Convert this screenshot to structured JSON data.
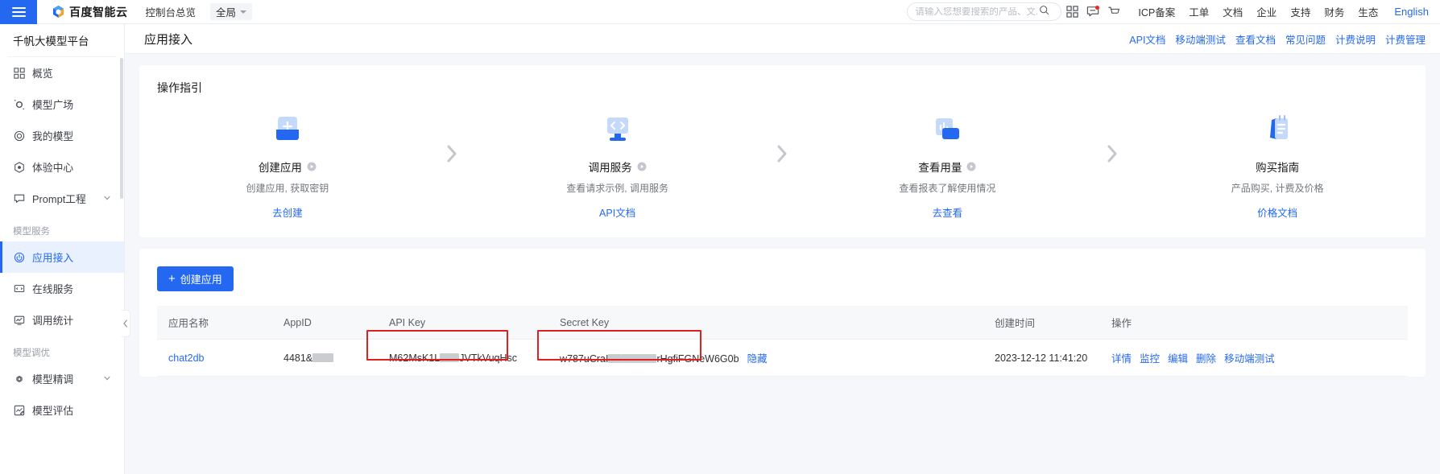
{
  "topbar": {
    "menu_icon": "hamburger-icon",
    "brand": "百度智能云",
    "console_link": "控制台总览",
    "scope": "全局",
    "search_placeholder": "请输入您想要搜索的产品、文...",
    "icons": [
      "grid-apps-icon",
      "message-icon",
      "cart-icon"
    ],
    "nav": [
      {
        "label": "ICP备案"
      },
      {
        "label": "工单"
      },
      {
        "label": "文档"
      },
      {
        "label": "企业"
      },
      {
        "label": "支持"
      },
      {
        "label": "财务"
      },
      {
        "label": "生态"
      }
    ],
    "language": "English"
  },
  "sidebar": {
    "title": "千帆大模型平台",
    "items": [
      {
        "label": "概览",
        "icon": "grid-icon",
        "active": false,
        "expandable": false
      },
      {
        "label": "模型广场",
        "icon": "cube-icon",
        "active": false,
        "expandable": false
      },
      {
        "label": "我的模型",
        "icon": "target-icon",
        "active": false,
        "expandable": false
      },
      {
        "label": "体验中心",
        "icon": "hexagon-icon",
        "active": false,
        "expandable": false
      },
      {
        "label": "Prompt工程",
        "icon": "chat-icon",
        "active": false,
        "expandable": true
      }
    ],
    "groups": [
      {
        "label": "模型服务",
        "items": [
          {
            "label": "应用接入",
            "icon": "power-icon",
            "active": true,
            "expandable": false
          },
          {
            "label": "在线服务",
            "icon": "monitor-icon",
            "active": false,
            "expandable": false
          },
          {
            "label": "调用统计",
            "icon": "chart-icon",
            "active": false,
            "expandable": false
          }
        ]
      },
      {
        "label": "模型调优",
        "items": [
          {
            "label": "模型精调",
            "icon": "gear-icon",
            "active": false,
            "expandable": true
          },
          {
            "label": "模型评估",
            "icon": "edit-chart-icon",
            "active": false,
            "expandable": false
          }
        ]
      }
    ]
  },
  "page": {
    "title": "应用接入",
    "links": [
      {
        "label": "API文档"
      },
      {
        "label": "移动端测试"
      },
      {
        "label": "查看文档"
      },
      {
        "label": "常见问题"
      },
      {
        "label": "计费说明"
      },
      {
        "label": "计费管理"
      }
    ]
  },
  "guide": {
    "title": "操作指引",
    "steps": [
      {
        "name": "创建应用",
        "desc": "创建应用, 获取密钥",
        "link": "去创建",
        "icon": "add-app-icon",
        "has_play": true
      },
      {
        "name": "调用服务",
        "desc": "查看请求示例, 调用服务",
        "link": "API文档",
        "icon": "code-monitor-icon",
        "has_play": true
      },
      {
        "name": "查看用量",
        "desc": "查看报表了解使用情况",
        "link": "去查看",
        "icon": "report-icon",
        "has_play": true
      },
      {
        "name": "购买指南",
        "desc": "产品购买, 计费及价格",
        "link": "价格文档",
        "icon": "clipboard-icon",
        "has_play": false
      }
    ]
  },
  "apps": {
    "create_button": "创建应用",
    "columns": [
      "应用名称",
      "AppID",
      "API Key",
      "Secret Key",
      "创建时间",
      "操作"
    ],
    "rows": [
      {
        "name": "chat2db",
        "appid_visible": "4481&",
        "appid_masked_width": 26,
        "api_key_prefix": "M62MsK1L",
        "api_key_mask1": 24,
        "api_key_suffix": "JVTkVuqHsc",
        "secret_key_prefix": "w787uCraI",
        "secret_key_mask1": 16,
        "secret_key_mask2": 44,
        "secret_key_suffix": "rHgfiFGNeW6G0b",
        "hide_label": "隐藏",
        "created_at": "2023-12-12 11:41:20",
        "ops": [
          "详情",
          "监控",
          "编辑",
          "删除",
          "移动端测试"
        ]
      }
    ]
  },
  "colors": {
    "accent": "#2468f2",
    "highlight_box": "#e02020",
    "sidebar_active_bg": "#eaf1fe"
  }
}
